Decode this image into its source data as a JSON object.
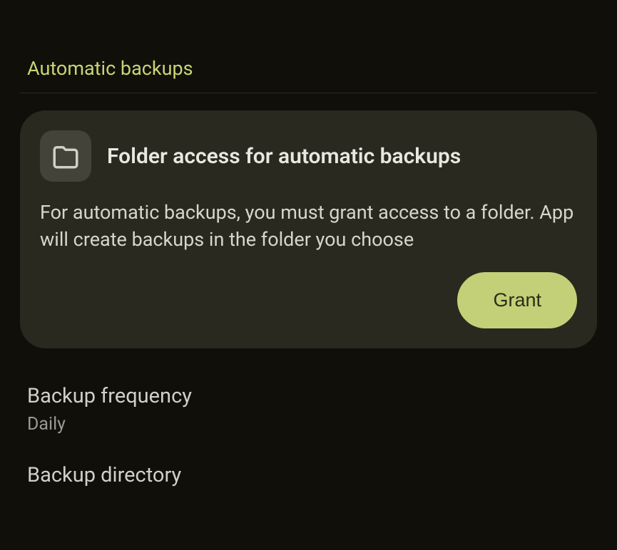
{
  "section_header": "Automatic backups",
  "card": {
    "icon_name": "folder-icon",
    "title": "Folder access for automatic backups",
    "description": "For automatic backups, you must grant access to a folder. App will create backups in the folder you choose",
    "grant_label": "Grant"
  },
  "settings": {
    "frequency": {
      "label": "Backup frequency",
      "value": "Daily"
    },
    "directory": {
      "label": "Backup directory"
    }
  },
  "colors": {
    "accent": "#c4d077",
    "card_bg": "#29291f",
    "bg": "#100f0a"
  }
}
